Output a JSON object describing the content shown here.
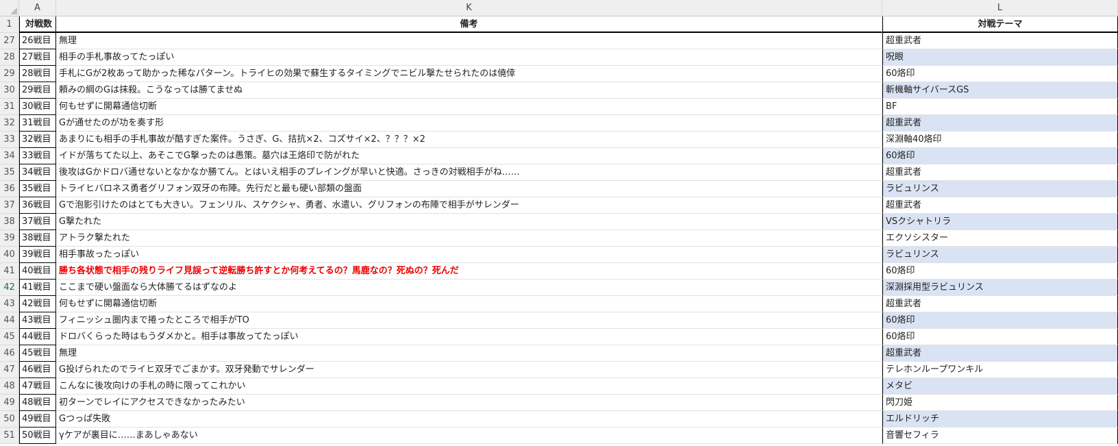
{
  "columns": {
    "corner": "",
    "a": "A",
    "k": "K",
    "l": "L"
  },
  "titles": {
    "a": "対戦数",
    "k": "備考",
    "l": "対戦テーマ"
  },
  "title_row_number": "1",
  "rows": [
    {
      "num": "27",
      "a": "26戦目",
      "k": "無理",
      "l": "超重武者"
    },
    {
      "num": "28",
      "a": "27戦目",
      "k": "相手の手札事故ってたっぽい",
      "l": "呪眼"
    },
    {
      "num": "29",
      "a": "28戦目",
      "k": "手札にGが2枚あって助かった稀なパターン。トライヒの効果で蘇生するタイミングでニビル撃たせられたのは僥倖",
      "l": "60烙印"
    },
    {
      "num": "30",
      "a": "29戦目",
      "k": "頼みの綱のGは抹殺。こうなっては勝てませぬ",
      "l": "斬機軸サイバースGS"
    },
    {
      "num": "31",
      "a": "30戦目",
      "k": "何もせずに開幕通信切断",
      "l": "BF"
    },
    {
      "num": "32",
      "a": "31戦目",
      "k": "Gが通せたのが功を奏す形",
      "l": "超重武者"
    },
    {
      "num": "33",
      "a": "32戦目",
      "k": "あまりにも相手の手札事故が酷すぎた案件。うさぎ、G、拮抗×2、コズサイ×2、？？？×2",
      "l": "深淵軸40烙印"
    },
    {
      "num": "34",
      "a": "33戦目",
      "k": "イドが落ちてた以上、あそこでG撃ったのは愚策。墓穴は王烙印で防がれた",
      "l": "60烙印"
    },
    {
      "num": "35",
      "a": "34戦目",
      "k": "後攻はGかドロバ通せないとなかなか勝てん。とはいえ相手のプレイングが早いと快適。さっきの対戦相手がね……",
      "l": "超重武者"
    },
    {
      "num": "36",
      "a": "35戦目",
      "k": "トライヒバロネス勇者グリフォン双牙の布陣。先行だと最も硬い部類の盤面",
      "l": "ラビュリンス"
    },
    {
      "num": "37",
      "a": "36戦目",
      "k": "Gで泡影引けたのはとても大きい。フェンリル、スケクシャ、勇者、水遣い、グリフォンの布陣で相手がサレンダー",
      "l": "超重武者"
    },
    {
      "num": "38",
      "a": "37戦目",
      "k": "G撃たれた",
      "l": "VSクシャトリラ"
    },
    {
      "num": "39",
      "a": "38戦目",
      "k": "アトラク撃たれた",
      "l": "エクソシスター"
    },
    {
      "num": "40",
      "a": "39戦目",
      "k": "相手事故ったっぽい",
      "l": "ラビュリンス"
    },
    {
      "num": "41",
      "a": "40戦目",
      "k": "勝ち各状態で相手の残りライフ見誤って逆転勝ち許すとか何考えてるの？馬鹿なの？死ぬの？死んだ",
      "l": "60烙印",
      "k_red": true
    },
    {
      "num": "42",
      "a": "41戦目",
      "k": "ここまで硬い盤面なら大体勝てるはずなのよ",
      "l": "深淵採用型ラビュリンス",
      "selected": true
    },
    {
      "num": "43",
      "a": "42戦目",
      "k": "何もせずに開幕通信切断",
      "l": "超重武者"
    },
    {
      "num": "44",
      "a": "43戦目",
      "k": "フィニッシュ圏内まで捲ったところで相手がTO",
      "l": "60烙印"
    },
    {
      "num": "45",
      "a": "44戦目",
      "k": "ドロバくらった時はもうダメかと。相手は事故ってたっぽい",
      "l": "60烙印"
    },
    {
      "num": "46",
      "a": "45戦目",
      "k": "無理",
      "l": "超重武者"
    },
    {
      "num": "47",
      "a": "46戦目",
      "k": "G投げられたのでライヒ双牙でごまかす。双牙発動でサレンダー",
      "l": "テレホンループワンキル"
    },
    {
      "num": "48",
      "a": "47戦目",
      "k": "こんなに後攻向けの手札の時に限ってこれかい",
      "l": "メタビ"
    },
    {
      "num": "49",
      "a": "48戦目",
      "k": "初ターンでレイにアクセスできなかったみたい",
      "l": "閃刀姫"
    },
    {
      "num": "50",
      "a": "49戦目",
      "k": "Gつっぱ失敗",
      "l": "エルドリッチ"
    },
    {
      "num": "51",
      "a": "50戦目",
      "k": "γケアが裏目に……まあしゃあない",
      "l": "音響セフィラ"
    }
  ],
  "colors": {
    "shade": "#dae3f3",
    "red_text": "#ee0000",
    "header_bg": "#efefef"
  }
}
